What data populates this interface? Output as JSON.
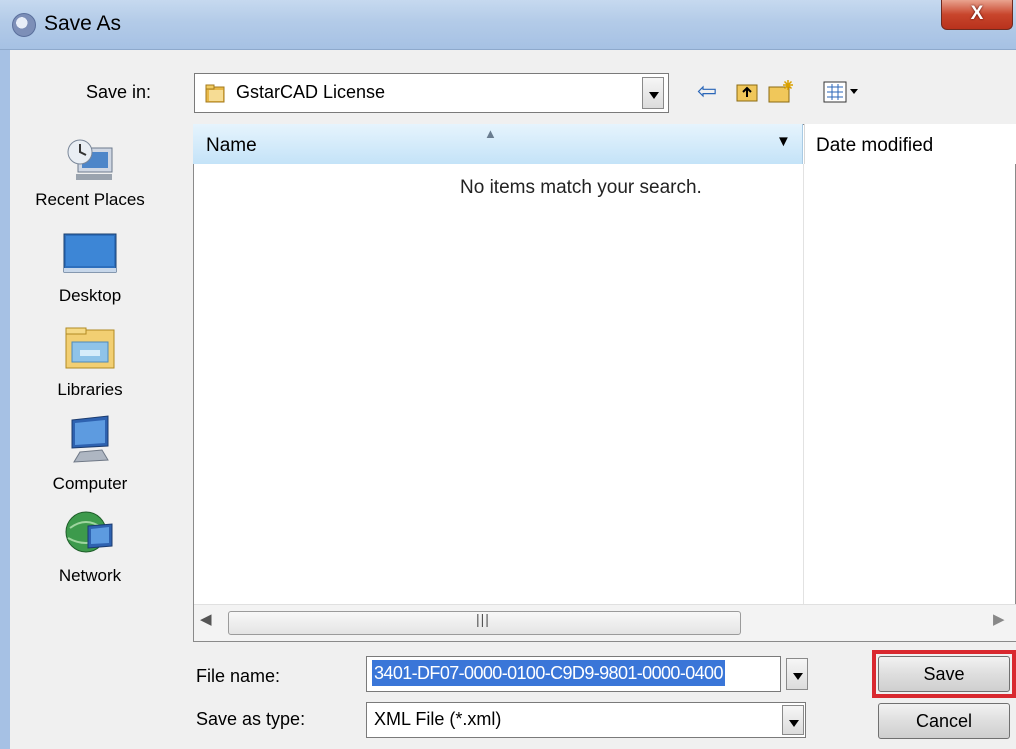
{
  "window": {
    "title": "Save As",
    "close_label": "X"
  },
  "toolbar": {
    "save_in_label": "Save in:",
    "save_in_value": "GstarCAD License",
    "icons": [
      "back-arrow-icon",
      "up-folder-icon",
      "new-folder-icon",
      "view-menu-icon"
    ]
  },
  "places": [
    {
      "label": "Recent Places",
      "icon": "recent-places-icon"
    },
    {
      "label": "Desktop",
      "icon": "desktop-icon"
    },
    {
      "label": "Libraries",
      "icon": "libraries-icon"
    },
    {
      "label": "Computer",
      "icon": "computer-icon"
    },
    {
      "label": "Network",
      "icon": "network-icon"
    }
  ],
  "list": {
    "columns": [
      "Name",
      "Date modified"
    ],
    "empty_message": "No items match your search."
  },
  "form": {
    "file_name_label": "File name:",
    "file_name_value": "3401-DF07-0000-0100-C9D9-9801-0000-0400",
    "save_type_label": "Save as type:",
    "save_type_value": "XML File (*.xml)"
  },
  "buttons": {
    "save": "Save",
    "cancel": "Cancel"
  },
  "colors": {
    "highlight": "#d9282f",
    "selection": "#3a76d8",
    "header": "#c4e3f8"
  }
}
